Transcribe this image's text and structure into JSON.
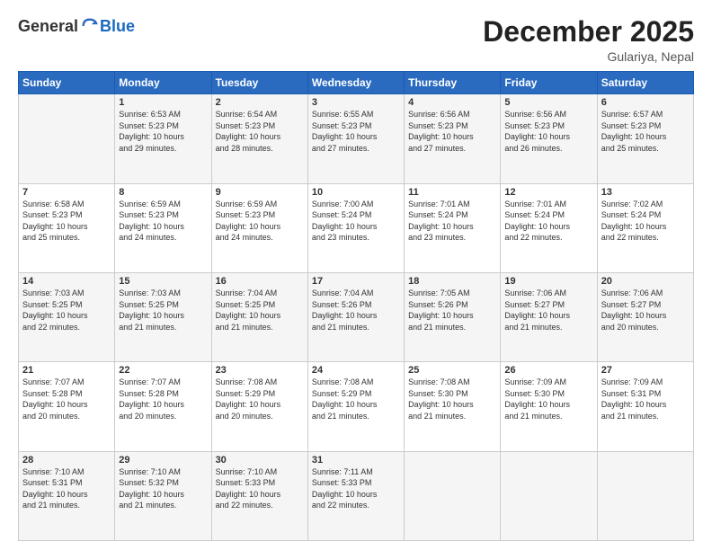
{
  "logo": {
    "general": "General",
    "blue": "Blue"
  },
  "title": "December 2025",
  "location": "Gulariya, Nepal",
  "weekdays": [
    "Sunday",
    "Monday",
    "Tuesday",
    "Wednesday",
    "Thursday",
    "Friday",
    "Saturday"
  ],
  "weeks": [
    [
      {
        "day": "",
        "info": ""
      },
      {
        "day": "1",
        "info": "Sunrise: 6:53 AM\nSunset: 5:23 PM\nDaylight: 10 hours\nand 29 minutes."
      },
      {
        "day": "2",
        "info": "Sunrise: 6:54 AM\nSunset: 5:23 PM\nDaylight: 10 hours\nand 28 minutes."
      },
      {
        "day": "3",
        "info": "Sunrise: 6:55 AM\nSunset: 5:23 PM\nDaylight: 10 hours\nand 27 minutes."
      },
      {
        "day": "4",
        "info": "Sunrise: 6:56 AM\nSunset: 5:23 PM\nDaylight: 10 hours\nand 27 minutes."
      },
      {
        "day": "5",
        "info": "Sunrise: 6:56 AM\nSunset: 5:23 PM\nDaylight: 10 hours\nand 26 minutes."
      },
      {
        "day": "6",
        "info": "Sunrise: 6:57 AM\nSunset: 5:23 PM\nDaylight: 10 hours\nand 25 minutes."
      }
    ],
    [
      {
        "day": "7",
        "info": "Sunrise: 6:58 AM\nSunset: 5:23 PM\nDaylight: 10 hours\nand 25 minutes."
      },
      {
        "day": "8",
        "info": "Sunrise: 6:59 AM\nSunset: 5:23 PM\nDaylight: 10 hours\nand 24 minutes."
      },
      {
        "day": "9",
        "info": "Sunrise: 6:59 AM\nSunset: 5:23 PM\nDaylight: 10 hours\nand 24 minutes."
      },
      {
        "day": "10",
        "info": "Sunrise: 7:00 AM\nSunset: 5:24 PM\nDaylight: 10 hours\nand 23 minutes."
      },
      {
        "day": "11",
        "info": "Sunrise: 7:01 AM\nSunset: 5:24 PM\nDaylight: 10 hours\nand 23 minutes."
      },
      {
        "day": "12",
        "info": "Sunrise: 7:01 AM\nSunset: 5:24 PM\nDaylight: 10 hours\nand 22 minutes."
      },
      {
        "day": "13",
        "info": "Sunrise: 7:02 AM\nSunset: 5:24 PM\nDaylight: 10 hours\nand 22 minutes."
      }
    ],
    [
      {
        "day": "14",
        "info": "Sunrise: 7:03 AM\nSunset: 5:25 PM\nDaylight: 10 hours\nand 22 minutes."
      },
      {
        "day": "15",
        "info": "Sunrise: 7:03 AM\nSunset: 5:25 PM\nDaylight: 10 hours\nand 21 minutes."
      },
      {
        "day": "16",
        "info": "Sunrise: 7:04 AM\nSunset: 5:25 PM\nDaylight: 10 hours\nand 21 minutes."
      },
      {
        "day": "17",
        "info": "Sunrise: 7:04 AM\nSunset: 5:26 PM\nDaylight: 10 hours\nand 21 minutes."
      },
      {
        "day": "18",
        "info": "Sunrise: 7:05 AM\nSunset: 5:26 PM\nDaylight: 10 hours\nand 21 minutes."
      },
      {
        "day": "19",
        "info": "Sunrise: 7:06 AM\nSunset: 5:27 PM\nDaylight: 10 hours\nand 21 minutes."
      },
      {
        "day": "20",
        "info": "Sunrise: 7:06 AM\nSunset: 5:27 PM\nDaylight: 10 hours\nand 20 minutes."
      }
    ],
    [
      {
        "day": "21",
        "info": "Sunrise: 7:07 AM\nSunset: 5:28 PM\nDaylight: 10 hours\nand 20 minutes."
      },
      {
        "day": "22",
        "info": "Sunrise: 7:07 AM\nSunset: 5:28 PM\nDaylight: 10 hours\nand 20 minutes."
      },
      {
        "day": "23",
        "info": "Sunrise: 7:08 AM\nSunset: 5:29 PM\nDaylight: 10 hours\nand 20 minutes."
      },
      {
        "day": "24",
        "info": "Sunrise: 7:08 AM\nSunset: 5:29 PM\nDaylight: 10 hours\nand 21 minutes."
      },
      {
        "day": "25",
        "info": "Sunrise: 7:08 AM\nSunset: 5:30 PM\nDaylight: 10 hours\nand 21 minutes."
      },
      {
        "day": "26",
        "info": "Sunrise: 7:09 AM\nSunset: 5:30 PM\nDaylight: 10 hours\nand 21 minutes."
      },
      {
        "day": "27",
        "info": "Sunrise: 7:09 AM\nSunset: 5:31 PM\nDaylight: 10 hours\nand 21 minutes."
      }
    ],
    [
      {
        "day": "28",
        "info": "Sunrise: 7:10 AM\nSunset: 5:31 PM\nDaylight: 10 hours\nand 21 minutes."
      },
      {
        "day": "29",
        "info": "Sunrise: 7:10 AM\nSunset: 5:32 PM\nDaylight: 10 hours\nand 21 minutes."
      },
      {
        "day": "30",
        "info": "Sunrise: 7:10 AM\nSunset: 5:33 PM\nDaylight: 10 hours\nand 22 minutes."
      },
      {
        "day": "31",
        "info": "Sunrise: 7:11 AM\nSunset: 5:33 PM\nDaylight: 10 hours\nand 22 minutes."
      },
      {
        "day": "",
        "info": ""
      },
      {
        "day": "",
        "info": ""
      },
      {
        "day": "",
        "info": ""
      }
    ]
  ]
}
